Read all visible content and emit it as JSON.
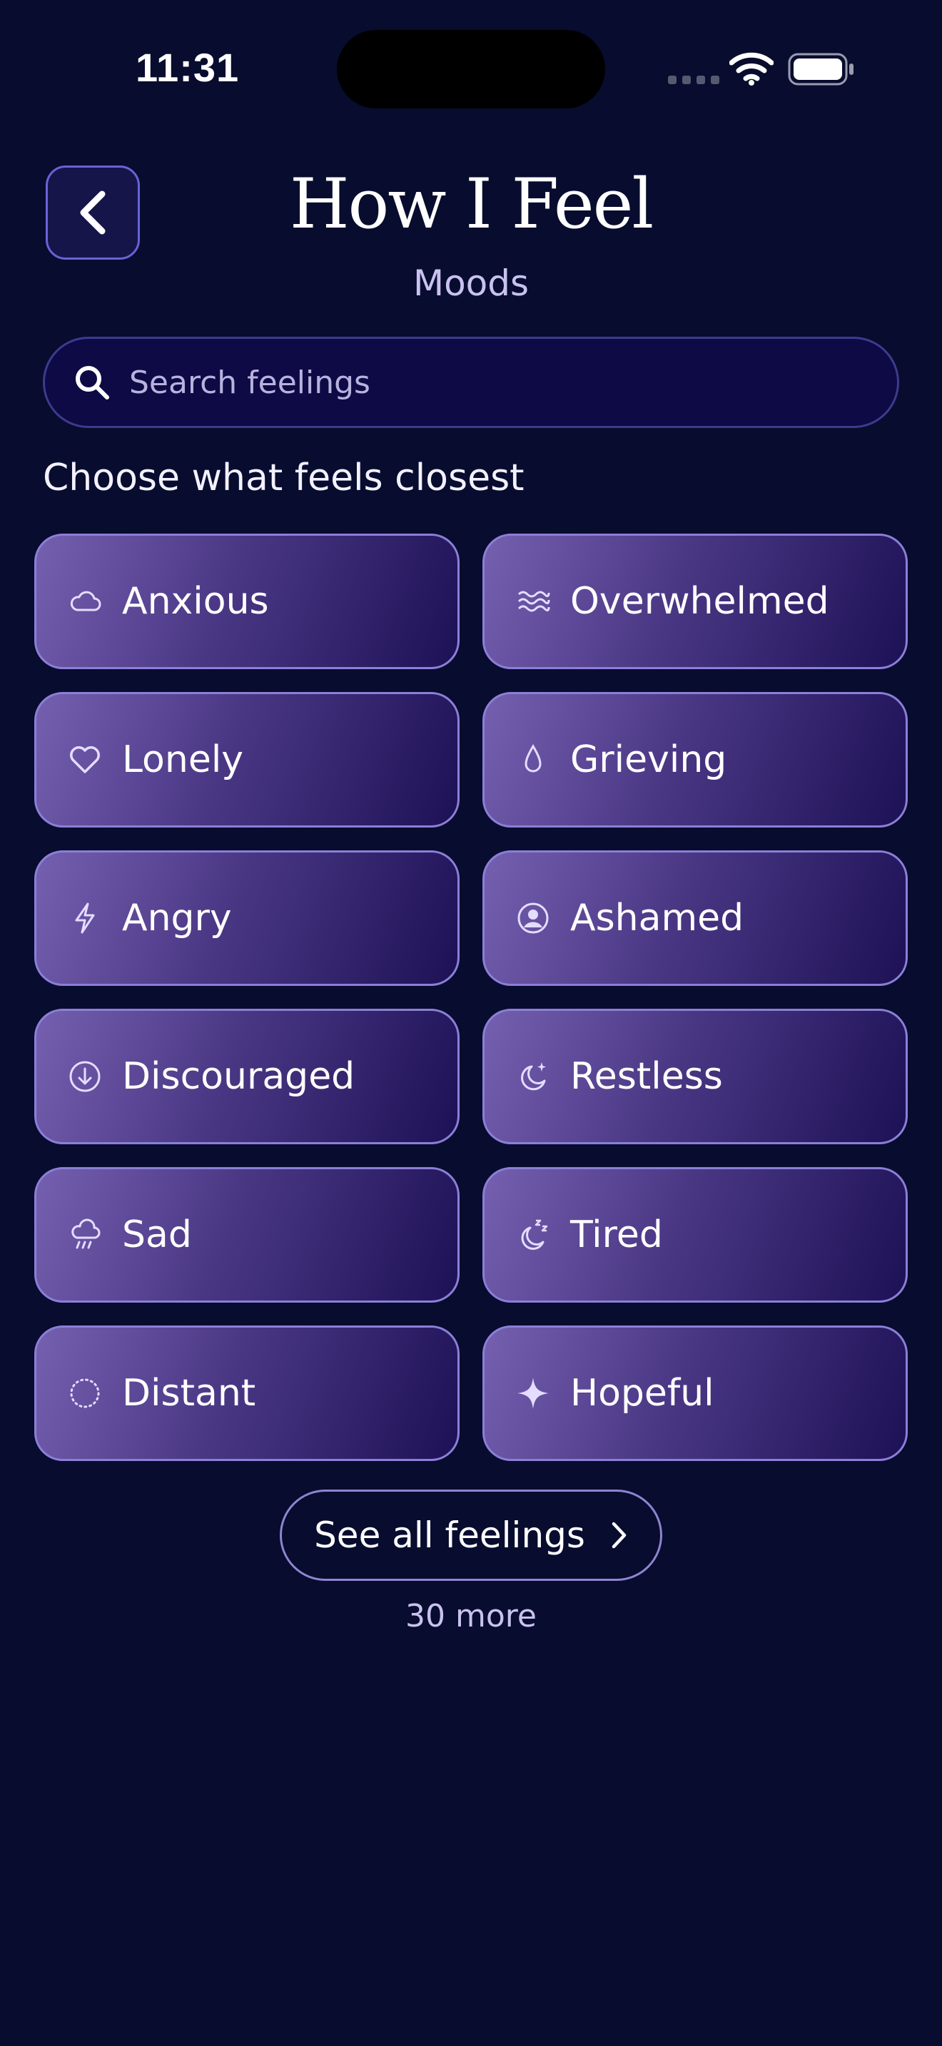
{
  "status_bar": {
    "time": "11:31"
  },
  "header": {
    "title": "How I Feel",
    "subtitle": "Moods"
  },
  "search": {
    "placeholder": "Search feelings"
  },
  "section": {
    "heading": "Choose what feels closest"
  },
  "moods": [
    {
      "label": "Anxious",
      "icon": "cloud-icon"
    },
    {
      "label": "Overwhelmed",
      "icon": "waves-icon"
    },
    {
      "label": "Lonely",
      "icon": "heart-icon"
    },
    {
      "label": "Grieving",
      "icon": "droplet-icon"
    },
    {
      "label": "Angry",
      "icon": "lightning-icon"
    },
    {
      "label": "Ashamed",
      "icon": "person-circle-icon"
    },
    {
      "label": "Discouraged",
      "icon": "arrow-down-circle-icon"
    },
    {
      "label": "Restless",
      "icon": "moon-sparkle-icon"
    },
    {
      "label": "Sad",
      "icon": "rain-cloud-icon"
    },
    {
      "label": "Tired",
      "icon": "moon-zzz-icon"
    },
    {
      "label": "Distant",
      "icon": "dotted-circle-icon"
    },
    {
      "label": "Hopeful",
      "icon": "sparkle-icon"
    }
  ],
  "footer": {
    "see_all_label": "See all feelings",
    "more_count": "30 more"
  },
  "colors": {
    "background": "#080c2e",
    "accent": "#6a62d6",
    "card_border": "#8b7fd8"
  }
}
